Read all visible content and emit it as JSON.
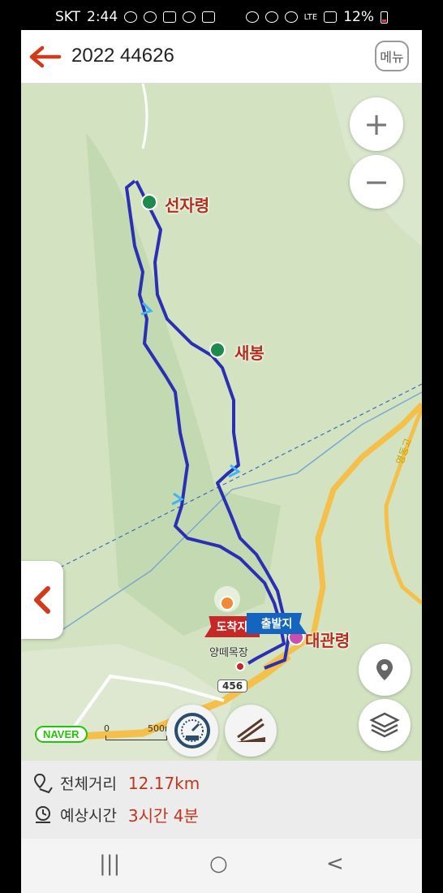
{
  "status_bar": {
    "carrier": "SKT",
    "time": "2:44",
    "network": "LTE",
    "battery": "12%"
  },
  "header": {
    "title": "2022 44626",
    "menu_label": "메뉴"
  },
  "map": {
    "peaks": [
      {
        "name": "선자령"
      },
      {
        "name": "새봉"
      }
    ],
    "start_label": "출발지",
    "end_label": "도착지",
    "pass_label": "대관령",
    "place_label": "양떼목장",
    "road_number": "456",
    "provider": "NAVER",
    "scale": {
      "start": "0",
      "end": "500m"
    },
    "road_name_vertical": "영동고",
    "colors": {
      "route": "#2b2fb3",
      "accent": "#c1361e",
      "terrain": "#cfe0bd"
    },
    "controls": [
      "plus-icon",
      "minus-icon",
      "location-pin-icon",
      "layers-icon",
      "speedometer-icon",
      "incline-icon"
    ]
  },
  "summary": {
    "distance_label": "전체거리",
    "distance_value": "12.17km",
    "time_label": "예상시간",
    "time_value": "3시간 4분"
  },
  "system_nav": {
    "recents": "|||",
    "home": "○",
    "back": "<"
  }
}
